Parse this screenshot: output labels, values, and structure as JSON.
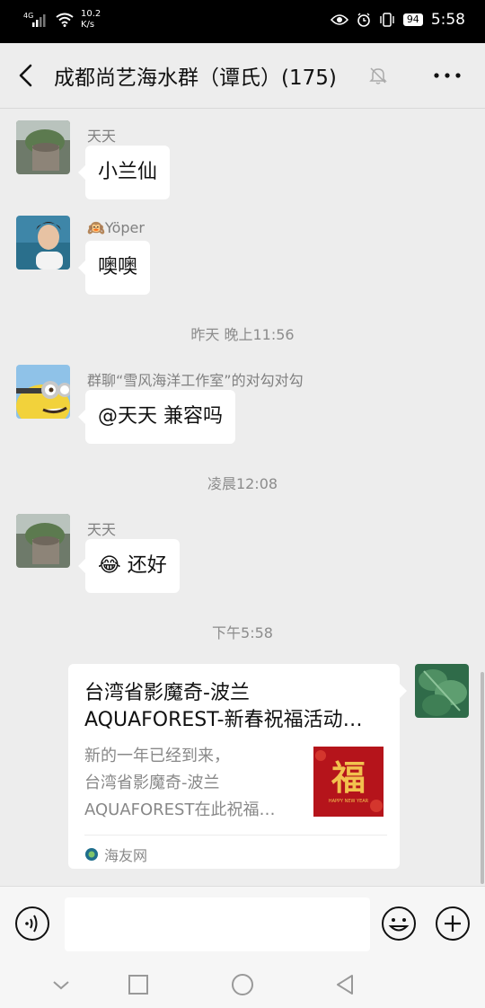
{
  "status_bar": {
    "network": "4G",
    "speed_value": "10.2",
    "speed_unit": "K/s",
    "battery": "94",
    "time": "5:58"
  },
  "header": {
    "title": "成都尚艺海水群（谭氏）(175)"
  },
  "messages": [
    {
      "sender": "天天",
      "text": "小兰仙"
    },
    {
      "sender": "🙉Yöper",
      "text": "噢噢"
    },
    {
      "time": "昨天 晚上11:56"
    },
    {
      "sender": "群聊“雪风海洋工作室”的对勾对勾",
      "text": "@天天  兼容吗"
    },
    {
      "time": "凌晨12:08"
    },
    {
      "sender": "天天",
      "text": "😂 还好"
    },
    {
      "time": "下午5:58"
    }
  ],
  "link_card": {
    "title_line1": "台湾省影魔奇-波兰",
    "title_line2": "AQUAFOREST-新春祝福活动…",
    "desc_line1": "新的一年已经到来，",
    "desc_line2": "台湾省影魔奇-波兰",
    "desc_line3": "AQUAFOREST在此祝福…",
    "thumb_text": "福",
    "thumb_caption": "HAPPY NEW YEAR",
    "source": "海友网"
  },
  "input": {
    "placeholder": ""
  },
  "colors": {
    "background": "#ededed",
    "bubble": "#ffffff",
    "status_bar": "#000000",
    "timestamp": "#8c8c8c"
  },
  "icons": {
    "back": "chevron-left-icon",
    "mute": "bell-off-icon",
    "more": "ellipsis-icon",
    "voice": "voice-icon",
    "emoji": "smiley-icon",
    "plus": "plus-icon"
  }
}
